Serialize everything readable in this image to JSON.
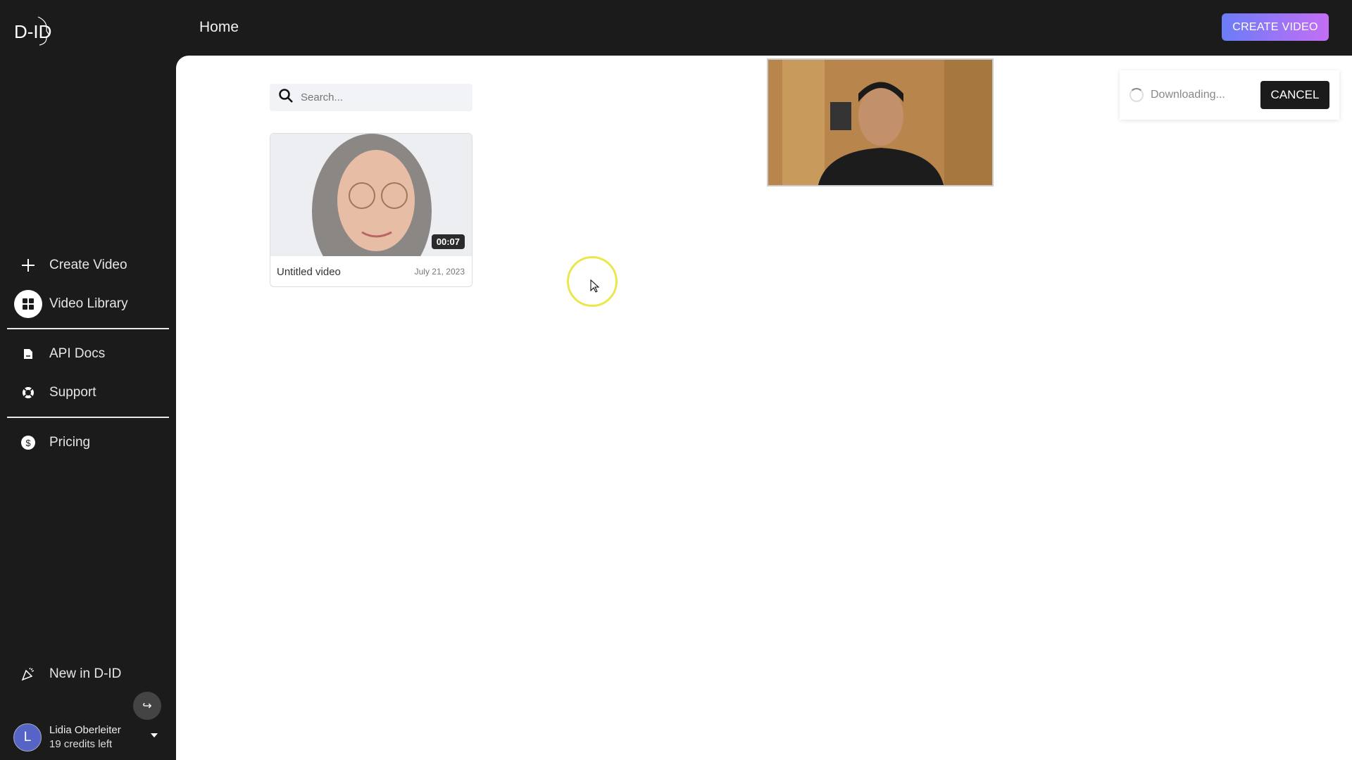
{
  "header": {
    "logo_text": "D-ID",
    "title": "Home",
    "create_button": "CREATE VIDEO"
  },
  "sidebar": {
    "items": [
      {
        "label": "Create Video",
        "icon": "plus-icon"
      },
      {
        "label": "Video Library",
        "icon": "grid-icon"
      },
      {
        "label": "API Docs",
        "icon": "document-icon"
      },
      {
        "label": "Support",
        "icon": "lifebuoy-icon"
      },
      {
        "label": "Pricing",
        "icon": "dollar-icon"
      },
      {
        "label": "New in D-ID",
        "icon": "party-popper-icon"
      }
    ],
    "user": {
      "initial": "L",
      "name": "Lidia Oberleiter",
      "credits": "19 credits left"
    }
  },
  "search": {
    "placeholder": "Search..."
  },
  "videos": [
    {
      "title": "Untitled video",
      "date": "July 21, 2023",
      "duration": "00:07"
    }
  ],
  "toast": {
    "status": "Downloading...",
    "cancel": "CANCEL"
  },
  "colors": {
    "accent_start": "#6b7cf7",
    "accent_end": "#c46ef5",
    "sidebar_bg": "#1b1b1c"
  }
}
